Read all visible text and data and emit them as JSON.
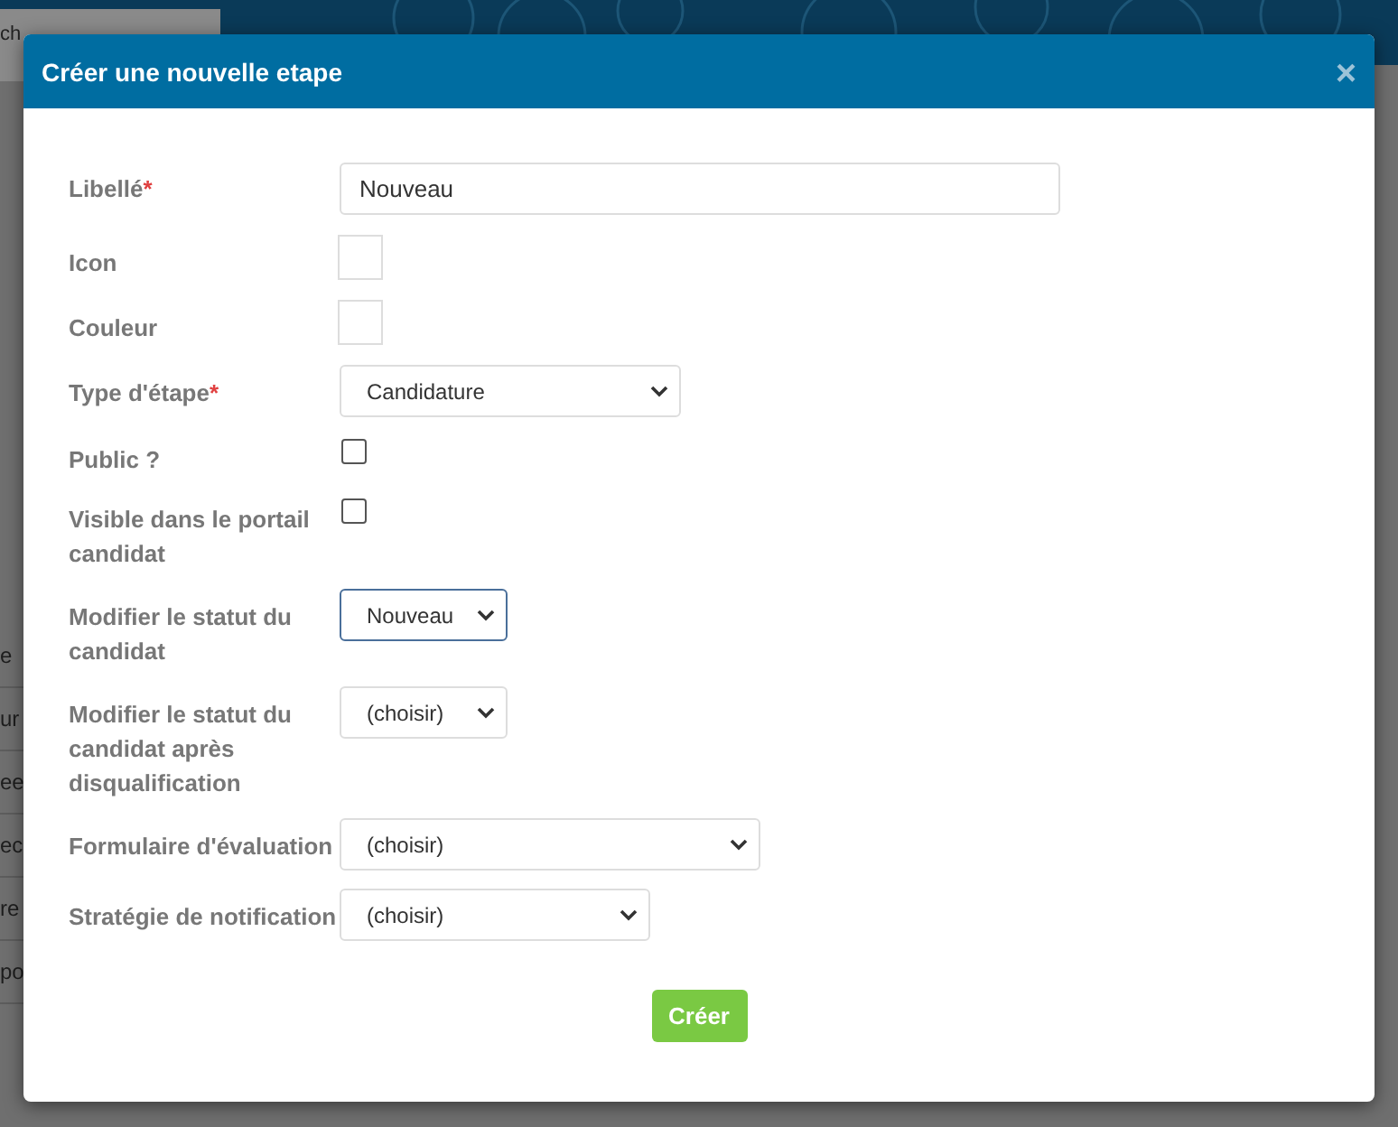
{
  "background": {
    "search_tab": "ch",
    "rows": [
      "e",
      "ur",
      "ee",
      "ec",
      "re",
      "po"
    ]
  },
  "dialog": {
    "title": "Créer une nouvelle etape",
    "close": "×",
    "fields": [
      {
        "kind": "text",
        "label": "Libellé",
        "required_mark": "*",
        "value": "Nouveau"
      },
      {
        "kind": "swatch",
        "label": "Icon"
      },
      {
        "kind": "swatch",
        "label": "Couleur"
      },
      {
        "kind": "select",
        "label": "Type d'étape",
        "required_mark": "*",
        "value": "Candidature",
        "focused": false
      },
      {
        "kind": "checkbox",
        "label": "Public ?",
        "checked": false
      },
      {
        "kind": "checkbox",
        "label": "Visible dans le portail candidat",
        "checked": false
      },
      {
        "kind": "select",
        "label": "Modifier le statut du candidat",
        "value": "Nouveau",
        "focused": true
      },
      {
        "kind": "select",
        "label": "Modifier le statut du candidat après disqualification",
        "value": "(choisir)",
        "focused": false
      },
      {
        "kind": "select",
        "label": "Formulaire d'évaluation",
        "value": "(choisir)",
        "focused": false
      },
      {
        "kind": "select",
        "label": "Stratégie de notification",
        "value": "(choisir)",
        "focused": false
      }
    ],
    "submit": "Créer"
  }
}
